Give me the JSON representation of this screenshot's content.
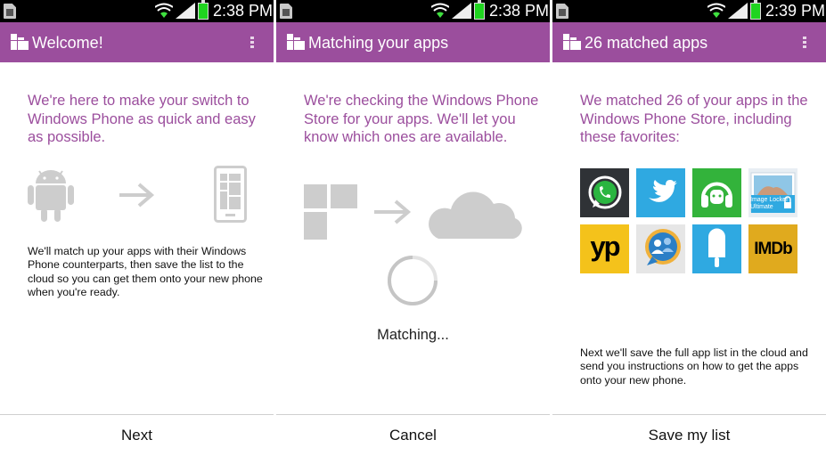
{
  "panels": [
    {
      "time": "2:38 PM",
      "title": "Welcome!",
      "headline": "We're here to make your switch to Windows Phone as quick and easy as possible.",
      "body": "We'll match up your apps with their Windows Phone counterparts, then save the list to the cloud so you can get them onto your new phone when you're ready.",
      "button": "Next"
    },
    {
      "time": "2:38 PM",
      "title": "Matching your apps",
      "headline": "We're checking the Windows Phone Store for your apps. We'll let you know which ones are available.",
      "status": "Matching...",
      "button": "Cancel"
    },
    {
      "time": "2:39 PM",
      "title": "26 matched apps",
      "headline": "We matched 26 of your apps in the Windows Phone Store, including these favorites:",
      "apps": [
        {
          "name": "whatsapp-icon",
          "label": ""
        },
        {
          "name": "twitter-icon",
          "label": ""
        },
        {
          "name": "headphones-icon",
          "label": ""
        },
        {
          "name": "image-locker-icon",
          "label": "Image Locker Ultimate"
        },
        {
          "name": "yp-icon",
          "label": "yp"
        },
        {
          "name": "chat-people-icon",
          "label": ""
        },
        {
          "name": "popsicle-icon",
          "label": ""
        },
        {
          "name": "imdb-icon",
          "label": "IMDb"
        }
      ],
      "body": "Next we'll save the full app list in the cloud and send you instructions on how to get the apps onto your new phone.",
      "button": "Save my list"
    }
  ],
  "colors": {
    "accent": "#9b4e9d",
    "statusbar": "#000000",
    "icon_gray": "#cdcdcd"
  }
}
